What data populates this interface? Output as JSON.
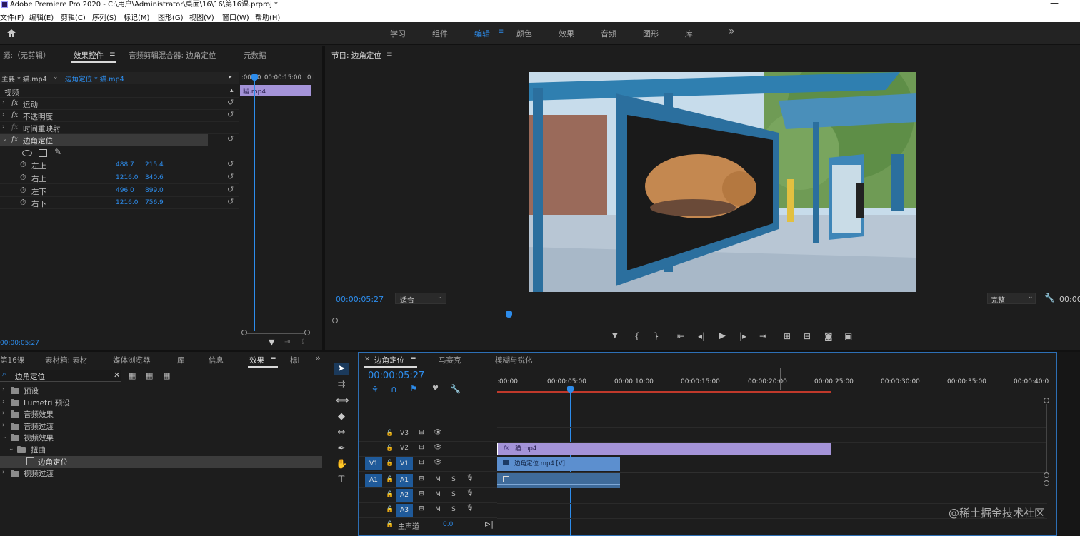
{
  "window": {
    "title": "Adobe Premiere Pro 2020 - C:\\用户\\Administrator\\桌面\\16\\16\\第16课.prproj *"
  },
  "menu": [
    "文件(F)",
    "编辑(E)",
    "剪辑(C)",
    "序列(S)",
    "标记(M)",
    "图形(G)",
    "视图(V)",
    "窗口(W)",
    "帮助(H)"
  ],
  "workspaces": {
    "items": [
      "学习",
      "组件",
      "编辑",
      "颜色",
      "效果",
      "音频",
      "图形",
      "库"
    ],
    "active": "编辑",
    "more": "»"
  },
  "effect_controls": {
    "tabs": [
      "源:（无剪辑）",
      "效果控件",
      "音频剪辑混合器: 边角定位",
      "元数据"
    ],
    "active_tab": "效果控件",
    "master_clip": "主要 * 猫.mp4",
    "sequence_clip": "边角定位 * 猫.mp4",
    "timecode_start": ":00:00",
    "timecode_mid": "00:00:15:00",
    "timecode_end": "0",
    "clip_label": "猫.mp4",
    "section": "视频",
    "effects": [
      "运动",
      "不透明度",
      "时间重映射",
      "边角定位"
    ],
    "params": [
      {
        "name": "左上",
        "x": "488.7",
        "y": "215.4"
      },
      {
        "name": "右上",
        "x": "1216.0",
        "y": "340.6"
      },
      {
        "name": "左下",
        "x": "496.0",
        "y": "899.0"
      },
      {
        "name": "右下",
        "x": "1216.0",
        "y": "756.9"
      }
    ],
    "current_time": "00:00:05:27"
  },
  "program": {
    "title": "节目: 边角定位",
    "timecode": "00:00:05:27",
    "fit": "适合",
    "quality": "完整",
    "right_timecode": "00:00",
    "playhead_fraction": 0.09
  },
  "project": {
    "tabs": [
      "第16课",
      "素材箱: 素材",
      "媒体浏览器",
      "库",
      "信息",
      "效果",
      "标i"
    ],
    "active_tab": "效果",
    "search_value": "边角定位",
    "tree": [
      {
        "label": "预设",
        "level": 0
      },
      {
        "label": "Lumetri 预设",
        "level": 0
      },
      {
        "label": "音频效果",
        "level": 0
      },
      {
        "label": "音频过渡",
        "level": 0
      },
      {
        "label": "视频效果",
        "level": 0
      },
      {
        "label": "扭曲",
        "level": 1
      },
      {
        "label": "边角定位",
        "level": 2
      },
      {
        "label": "视频过渡",
        "level": 0
      }
    ]
  },
  "timeline": {
    "tabs": [
      "边角定位",
      "马赛克",
      "模糊与锐化"
    ],
    "active_tab": "边角定位",
    "timecode": "00:00:05:27",
    "ruler": [
      ":00:00",
      "00:00:05:00",
      "00:00:10:00",
      "00:00:15:00",
      "00:00:20:00",
      "00:00:25:00",
      "00:00:30:00",
      "00:00:35:00",
      "00:00:40:0"
    ],
    "video_tracks": [
      "V3",
      "V2",
      "V1"
    ],
    "audio_tracks": [
      "A1",
      "A2",
      "A3"
    ],
    "source_video": "V1",
    "source_audio": "A1",
    "mute": "M",
    "solo": "S",
    "master": "主声道",
    "master_value": "0.0",
    "clips": {
      "v2": "猫.mp4",
      "v1": "边角定位.mp4 [V]",
      "v2_fx": "fx"
    }
  },
  "watermark": "@稀土掘金技术社区"
}
